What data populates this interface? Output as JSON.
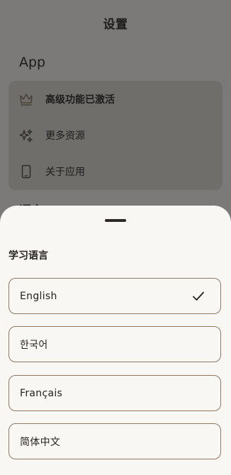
{
  "background": {
    "title": "设置",
    "section_app": "App",
    "items": [
      {
        "label": "高级功能已激活",
        "icon": "crown-icon"
      },
      {
        "label": "更多资源",
        "icon": "sparkles-icon"
      },
      {
        "label": "关于应用",
        "icon": "phone-icon"
      }
    ],
    "peek_section": "语言"
  },
  "sheet": {
    "title": "学习语言",
    "options": [
      {
        "label": "English",
        "selected": true
      },
      {
        "label": "한국어",
        "selected": false
      },
      {
        "label": "Français",
        "selected": false
      },
      {
        "label": "简体中文",
        "selected": false
      }
    ]
  },
  "colors": {
    "scrim": "#7b7a78",
    "sheet_bg": "#f9f7f3",
    "option_border": "#8d7a66",
    "text": "#24211e"
  }
}
